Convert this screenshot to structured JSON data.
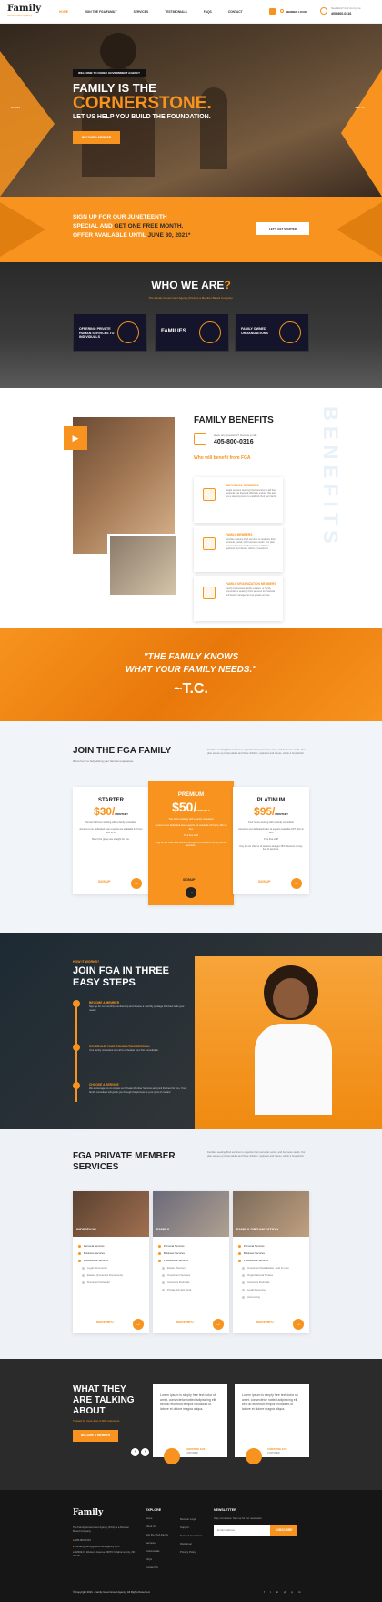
{
  "nav": {
    "logo": "Family",
    "logo_sub": "Government Agency",
    "links": [
      "HOME",
      "JOIN THE FGA FAMILY",
      "SERVICES",
      "TESTIMONIALS",
      "FAQS",
      "CONTACT"
    ],
    "member_login": "MEMBER LOGIN",
    "phone_label": "Need Help? Call Us Anytime",
    "phone": "405-800-0316"
  },
  "hero": {
    "kicker": "WELCOME TO FAMILY GOVERNMENT AGENCY",
    "line1": "FAMILY IS THE",
    "line2": "CORNERSTONE.",
    "line3": "LET US HELP YOU BUILD THE FOUNDATION.",
    "cta": "BECOME A MEMBER",
    "prev": "PREV",
    "next": "NEXT"
  },
  "promo": {
    "line1": "SIGN UP FOR OUR JUNETEENTH",
    "line2a": "SPECIAL AND ",
    "line2b": "GET ONE FREE MONTH.",
    "line3a": "OFFER AVAILABLE UNTIL ",
    "line3b": "JUNE 30, 2021*",
    "cta": "LET'S GET STARTED"
  },
  "who": {
    "title_a": "WHO WE ARE",
    "title_b": "?",
    "subtitle": "The Family Government Agency (FGA) is a Member Based Company.",
    "cards": [
      "OFFERING PRIVATE HUMAN SERVICES TO INDIVIDUALS",
      "FAMILIES",
      "FAMILY OWNED ORGANIZATIONS"
    ]
  },
  "benefits": {
    "watermark": "BENEFITS",
    "title": "FAMILY BENEFITS",
    "question": "Have any questions? Give us a call:",
    "phone": "405-800-0316",
    "who_label": "Who will benefit from FGA",
    "items": [
      {
        "title": "INDIVIDUAL MEMBERS",
        "desc": "Single persons seeking FGA services to aid their personal and financial efforts to endure. We also live a stepping stone to establish their own family."
      },
      {
        "title": "FAMILY MEMBERS",
        "desc": "Families seeking FGA services to organize their personal, social, and business needs. Our plan serves up to two adults and three children, nephews and nieces, within a household."
      },
      {
        "title": "FAMILY ORGANIZATION MEMBERS",
        "desc": "Family businesses, family estates, or family corporations seeking FGA services for financial and board management as private entities."
      }
    ]
  },
  "quote": {
    "line1": "\"THE FAMILY KNOWS",
    "line2": "WHAT YOUR FAMILY NEEDS.\"",
    "author": "~T.C."
  },
  "join": {
    "title": "JOIN THE FGA FAMILY",
    "subtitle": "We're here to help during your familiar experience.",
    "blurb": "Families seeking FGA services to organize their personal, social, and business needs. Our plan serves up to two adults and three children, nephews and nieces, within a household.",
    "plans": [
      {
        "name": "STARTER",
        "price": "$30/",
        "per": "MONTHLY",
        "lines": [
          "Soma's full-hour working with a family consultant",
          "Access to our dedicated team experts are available 9-5 from Mon to Fri",
          "Best if for group are straight for you."
        ],
        "cta": "SIGNUP"
      },
      {
        "name": "PREMIUM",
        "price": "$50/",
        "per": "MONTHLY",
        "lines": [
          "Two hours working with a family consultant",
          "Access to our dedicated team experts are available 24 hours, Mon to Sun",
          "Plus free stuff",
          "Pay for our eServe of services and get 15% discount on any line of services."
        ],
        "cta": "SIGNUP"
      },
      {
        "name": "PLATINUM",
        "price": "$95/",
        "per": "MONTHLY",
        "lines": [
          "Four hours working with a family consultant",
          "Access to our dedicated team of experts available 24/7 Mon to Sun",
          "Plus free stuff",
          "Pay for our eServe of services and get 15% discount on any line of services."
        ],
        "cta": "SIGNUP"
      }
    ]
  },
  "steps": {
    "kicker": "HOW IT WORKS?",
    "title1": "JOIN FGA IN THREE",
    "title2": "EASY STEPS",
    "items": [
      {
        "title": "BECOME A MEMBER",
        "desc": "Sign up for our monthly membership and choose a monthly package that best suits your needs."
      },
      {
        "title": "SCHEDULE YOUR CONSULTING SESSION",
        "desc": "Your family consultant will call to schedule your first consultation."
      },
      {
        "title": "CHOOSE A SERVICE",
        "desc": "We encourage you to review our Private Member Services and pick the best for you. Your family consultant will guide you through the process at your point of contact."
      }
    ]
  },
  "services": {
    "title1": "FGA PRIVATE MEMBER",
    "title2": "SERVICES",
    "blurb": "Families seeking FGA services to organize their personal, social, and business needs. Our plan serves up to two adults and three children, nephews and nieces, within a household.",
    "cards": [
      {
        "name": "INDIVIDUAL",
        "items": [
          "Personal Services",
          "Business Services",
          "Professional Services"
        ],
        "subs": [
          "Legal Documents",
          "Estates (Funeral & Documents)",
          "Document Defender"
        ],
        "more": "MORE INFO"
      },
      {
        "name": "FAMILY",
        "items": [
          "Personal Services",
          "Business Services",
          "Professional Services"
        ],
        "subs": [
          "Estate Planners",
          "Investment Services",
          "Insurance Referrals",
          "Private Ad Help Desk"
        ],
        "more": "MORE INFO"
      },
      {
        "name": "FAMILY ORGANIZATION",
        "items": [
          "Personal Services",
          "Business Services",
          "Professional Services"
        ],
        "subs": [
          "Investment Real Estate - and & more",
          "Organizational Trustee",
          "Insurance Referrals",
          "Legal Resources",
          "Accounting"
        ],
        "more": "MORE INFO"
      }
    ]
  },
  "talk": {
    "title1": "WHAT THEY",
    "title2": "ARE TALKING",
    "title3": "ABOUT",
    "sub": "Trusted by more than 3,000 customers",
    "cta": "BECOME A MEMBER",
    "testimonials": [
      {
        "text": "Lorem Ipsum is simply free text dolor sit amet, consectetur notted adipisicing elit sed do eiusmod tempor incididunt ut labore et dolore magna aliqua.",
        "name": "CHRISTINE EVE",
        "role": "CUSTOMER"
      },
      {
        "text": "Lorem Ipsum is simply free text dolor sit amet, consectetur notted adipisicing elit sed do eiusmod tempor incididunt ut labore et dolore magna aliqua.",
        "name": "CHRISTINE EVE",
        "role": "CUSTOMER"
      }
    ]
  },
  "footer": {
    "logo": "Family",
    "about": "The Family Government Agency (FGA) is a Member Based Company.",
    "phone": "405-800-0316",
    "email": "contact@familygovernmentagency.com",
    "address": "4260E N. Western Avenue #3870 Oklahoma City, OK 73118",
    "explore_title": "EXPLORE",
    "explore": [
      "Home",
      "About Us",
      "Join the FGA Family",
      "Services",
      "Testimonials",
      "FAQs",
      "Contact Us"
    ],
    "explore2": [
      "Member Login",
      "Support",
      "Terms & Conditions",
      "Disclaimer",
      "Privacy Policy"
    ],
    "news_title": "NEWSLETTER",
    "news_desc": "Stay connected. Sign up for our newsletter.",
    "email_placeholder": "Email address",
    "subscribe": "SUBSCRIBE",
    "copyright": "© Copyright 2021 - Family Government Agency. All Rights Reserved.",
    "social": [
      "f",
      "t",
      "in",
      "yt",
      "p",
      "in"
    ]
  },
  "colors": {
    "accent": "#f7931e",
    "dark": "#2b2b2b",
    "navy": "#14142a"
  }
}
